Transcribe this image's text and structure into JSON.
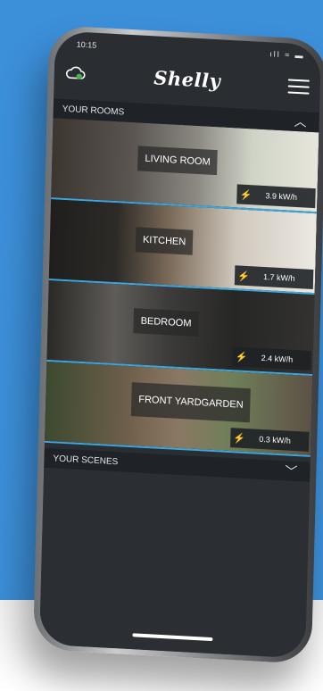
{
  "status_bar": {
    "time": "10:15",
    "icons": "ıll ≈ ▬"
  },
  "app": {
    "logo": "Shelly"
  },
  "rooms_section": {
    "title": "YOUR ROOMS"
  },
  "rooms": [
    {
      "name": "LIVING ROOM",
      "power": "3.9 kW/h"
    },
    {
      "name": "KITCHEN",
      "power": "1.7 kW/h"
    },
    {
      "name": "BEDROOM",
      "power": "2.4 kW/h"
    },
    {
      "name_line1": "FRONT YARD",
      "name_line2": "GARDEN",
      "power": "0.3 kW/h"
    }
  ],
  "scenes_section": {
    "title": "YOUR SCENES"
  },
  "colors": {
    "background": "#3c8fd9",
    "accent": "#3aa7e0",
    "screen": "#2a2d31"
  },
  "icons": [
    "cloud-icon",
    "menu-icon",
    "chevron-up-icon",
    "chevron-down-icon",
    "bolt-icon"
  ]
}
